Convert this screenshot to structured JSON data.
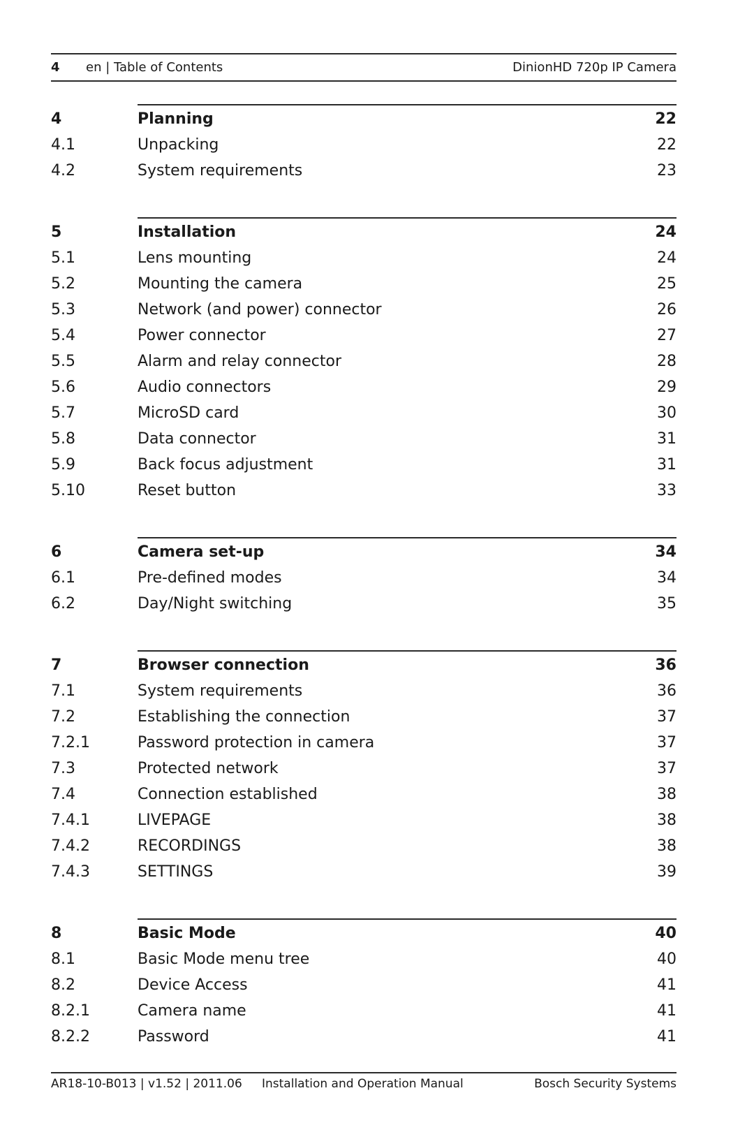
{
  "header": {
    "page_number": "4",
    "section": "en | Table of Contents",
    "product": "DinionHD 720p IP Camera"
  },
  "toc": [
    {
      "number": "4",
      "title": "Planning",
      "page": "22",
      "items": [
        {
          "number": "4.1",
          "title": "Unpacking",
          "page": "22"
        },
        {
          "number": "4.2",
          "title": "System requirements",
          "page": "23"
        }
      ]
    },
    {
      "number": "5",
      "title": "Installation",
      "page": "24",
      "items": [
        {
          "number": "5.1",
          "title": "Lens mounting",
          "page": "24"
        },
        {
          "number": "5.2",
          "title": "Mounting the camera",
          "page": "25"
        },
        {
          "number": "5.3",
          "title": "Network (and power) connector",
          "page": "26"
        },
        {
          "number": "5.4",
          "title": "Power connector",
          "page": "27"
        },
        {
          "number": "5.5",
          "title": "Alarm and relay connector",
          "page": "28"
        },
        {
          "number": "5.6",
          "title": "Audio connectors",
          "page": "29"
        },
        {
          "number": "5.7",
          "title": "MicroSD card",
          "page": "30"
        },
        {
          "number": "5.8",
          "title": "Data connector",
          "page": "31"
        },
        {
          "number": "5.9",
          "title": "Back focus adjustment",
          "page": "31"
        },
        {
          "number": "5.10",
          "title": "Reset button",
          "page": "33"
        }
      ]
    },
    {
      "number": "6",
      "title": "Camera set-up",
      "page": "34",
      "items": [
        {
          "number": "6.1",
          "title": "Pre-defined modes",
          "page": "34"
        },
        {
          "number": "6.2",
          "title": "Day/Night switching",
          "page": "35"
        }
      ]
    },
    {
      "number": "7",
      "title": "Browser connection",
      "page": "36",
      "items": [
        {
          "number": "7.1",
          "title": "System requirements",
          "page": "36"
        },
        {
          "number": "7.2",
          "title": "Establishing the connection",
          "page": "37"
        },
        {
          "number": "7.2.1",
          "title": "Password protection in camera",
          "page": "37"
        },
        {
          "number": "7.3",
          "title": "Protected network",
          "page": "37"
        },
        {
          "number": "7.4",
          "title": "Connection established",
          "page": "38"
        },
        {
          "number": "7.4.1",
          "title": "LIVEPAGE",
          "page": "38"
        },
        {
          "number": "7.4.2",
          "title": "RECORDINGS",
          "page": "38"
        },
        {
          "number": "7.4.3",
          "title": "SETTINGS",
          "page": "39"
        }
      ]
    },
    {
      "number": "8",
      "title": "Basic Mode",
      "page": "40",
      "items": [
        {
          "number": "8.1",
          "title": "Basic Mode menu tree",
          "page": "40"
        },
        {
          "number": "8.2",
          "title": "Device Access",
          "page": "41"
        },
        {
          "number": "8.2.1",
          "title": "Camera name",
          "page": "41"
        },
        {
          "number": "8.2.2",
          "title": "Password",
          "page": "41"
        }
      ]
    }
  ],
  "footer": {
    "document_id": "AR18-10-B013 | v1.52 | 2011.06",
    "document_title": "Installation and Operation Manual",
    "company": "Bosch Security Systems"
  }
}
